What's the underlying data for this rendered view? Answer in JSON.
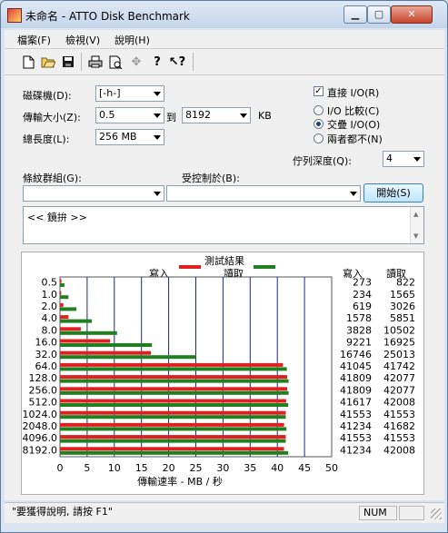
{
  "window": {
    "title": "未命名 - ATTO Disk Benchmark",
    "minimize": "▁",
    "maximize": "▢",
    "close": "✕"
  },
  "menu": {
    "file": "檔案(F)",
    "view": "檢視(V)",
    "help": "說明(H)"
  },
  "toolbar_icons": [
    "new-icon",
    "open-icon",
    "save-icon",
    "print-icon",
    "print-preview-icon",
    "move-icon",
    "help-icon",
    "context-help-icon"
  ],
  "form": {
    "drive_label": "磁碟機(D):",
    "drive_value": "[-h-]",
    "transfer_label": "傳輸大小(Z):",
    "transfer_from": "0.5",
    "to_label": "到",
    "transfer_to": "8192",
    "kb_label": "KB",
    "total_label": "總長度(L):",
    "total_value": "256 MB",
    "direct_io_label": "直接 I/O(R)",
    "direct_io_checked": true,
    "io_compare_label": "I/O 比較(C)",
    "overlapped_io_label": "交疊 I/O(O)",
    "neither_label": "兩者都不(N)",
    "queue_label": "佇列深度(Q):",
    "queue_value": "4",
    "pattern_label": "條紋群組(G):",
    "pattern_value": "",
    "controlled_label": "受控制於(B):",
    "controlled_value": "",
    "start_button": "開始(S)",
    "notes_text": "<< 鏡拚 >>"
  },
  "chart_data": {
    "type": "bar",
    "title": "測試結果",
    "legend_write": "寫入",
    "legend_read": "讀取",
    "col_write": "寫入",
    "col_read": "讀取",
    "xlabel": "傳輸速率 - MB / 秒",
    "xlim": [
      0,
      50
    ],
    "xticks": [
      "0",
      "5",
      "10",
      "15",
      "20",
      "25",
      "30",
      "35",
      "40",
      "45",
      "50"
    ],
    "categories": [
      "0.5",
      "1.0",
      "2.0",
      "4.0",
      "8.0",
      "16.0",
      "32.0",
      "64.0",
      "128.0",
      "256.0",
      "512.0",
      "1024.0",
      "2048.0",
      "4096.0",
      "8192.0"
    ],
    "series": [
      {
        "name": "寫入",
        "color": "#e02020",
        "values": [
          273,
          234,
          619,
          1578,
          3828,
          9221,
          16746,
          41045,
          41809,
          41809,
          41617,
          41553,
          41234,
          41553,
          41234
        ]
      },
      {
        "name": "讀取",
        "color": "#208020",
        "values": [
          822,
          1565,
          3026,
          5851,
          10502,
          16925,
          25013,
          41742,
          42077,
          42077,
          42008,
          41553,
          41682,
          41553,
          42008
        ]
      }
    ]
  },
  "status": {
    "help_text": "\"要獲得說明, 請按 F1\"",
    "num": "NUM"
  }
}
